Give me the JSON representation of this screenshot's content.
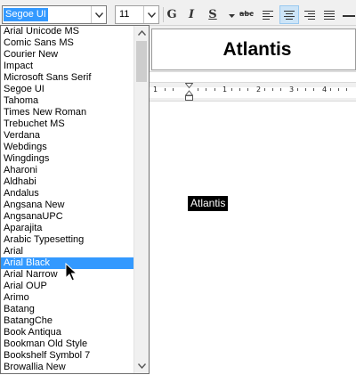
{
  "toolbar": {
    "font_name": "Segoe UI",
    "font_size": "11",
    "bold_label": "G",
    "italic_label": "I",
    "underline_label": "S"
  },
  "font_list": {
    "items": [
      "Arial Unicode MS",
      "Comic Sans MS",
      "Courier New",
      "Impact",
      "Microsoft Sans Serif",
      "Segoe UI",
      "Tahoma",
      "Times New Roman",
      "Trebuchet MS",
      "Verdana",
      "Webdings",
      "Wingdings",
      "Aharoni",
      "Aldhabi",
      "Andalus",
      "Angsana New",
      "AngsanaUPC",
      "Aparajita",
      "Arabic Typesetting",
      "Arial",
      "Arial Black",
      "Arial Narrow",
      "Arial OUP",
      "Arimo",
      "Batang",
      "BatangChe",
      "Book Antiqua",
      "Bookman Old Style",
      "Bookshelf Symbol 7",
      "Browallia New"
    ],
    "selected": "Arial Black"
  },
  "document": {
    "header_title": "Atlantis",
    "selected_text": "Atlantis"
  },
  "ruler": {
    "numbers": [
      "1",
      "1",
      "2",
      "3",
      "4"
    ]
  },
  "icons": {
    "combo_arrow": "chevron-down-icon",
    "scroll_up": "scroll-up-arrow-icon",
    "scroll_down": "scroll-down-arrow-icon",
    "cursor": "mouse-pointer-icon"
  },
  "colors": {
    "selection": "#3399ff",
    "toolbar_bg": "#f0f0f0",
    "highlight_text_bg": "#000000"
  }
}
